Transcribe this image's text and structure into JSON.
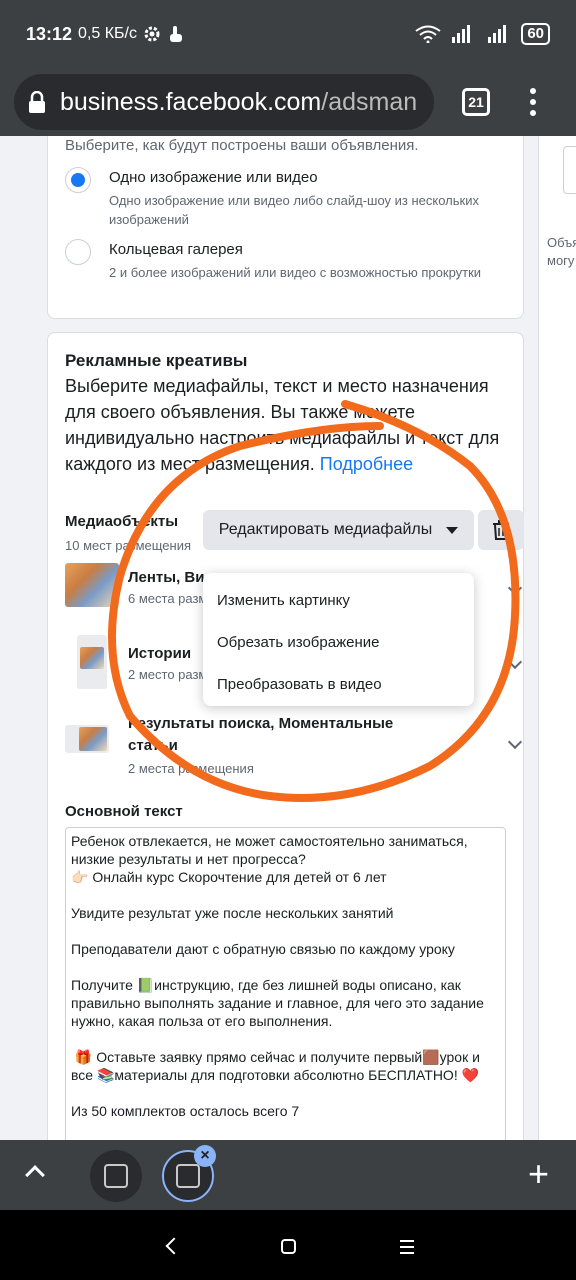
{
  "status": {
    "time": "13:12",
    "speed": "0,5 КБ/с",
    "battery": "60"
  },
  "browser": {
    "url_host": "business.facebook.com",
    "url_path": "/adsman",
    "tab_count": "21"
  },
  "format": {
    "intro": "Выберите, как будут построены ваши объявления.",
    "options": [
      {
        "title": "Одно изображение или видео",
        "desc": "Одно изображение или видео либо слайд-шоу из нескольких изображений",
        "selected": true
      },
      {
        "title": "Кольцевая галерея",
        "desc": "2 и более изображений или видео с возможностью прокрутки",
        "selected": false
      }
    ]
  },
  "right_panel": {
    "text_line1": "Объя",
    "text_line2": "могу"
  },
  "creatives": {
    "title": "Рекламные креативы",
    "description": "Выберите медиафайлы, текст и место назначения для своего объявления. Вы также можете индивидуально настроить медиафайлы и текст для каждого из мест размещения. ",
    "learn_more": "Подробнее",
    "media_label": "Медиаобъекты",
    "media_count": "10 мест размещения",
    "edit_media_button": "Редактировать медиафайлы",
    "placements": [
      {
        "title": "Ленты, Ви",
        "sub": "6 места разм"
      },
      {
        "title": "Истории",
        "sub": "2 место разм"
      },
      {
        "title": "Результаты поиска, Моментальные статьи",
        "sub": "2 места размещения"
      }
    ],
    "dropdown": [
      "Изменить картинку",
      "Обрезать изображение",
      "Преобразовать в видео"
    ],
    "primary_text_label": "Основной текст",
    "primary_text": "Ребенок отвлекается, не может самостоятельно заниматься, низкие результаты и нет прогресса?\n👉🏻 Онлайн курс Скорочтение для детей от 6 лет\n\nУвидите результат уже после нескольких занятий\n\nПреподаватели дают с обратную связью по каждому уроку\n\nПолучите 📗инструкцию, где без лишней воды описано, как правильно выполнять задание и главное, для чего это задание нужно, какая польза от его выполнения.\n\n 🎁 Оставьте заявку прямо сейчас и получите первый🟫урок и все 📚материалы для подготовки абсолютно БЕСПЛАТНО! ❤️\n\nИз 50 комплектов осталось всего 7\n\n"
  },
  "colors": {
    "accent": "#1877f2",
    "annotation": "#f26a1b",
    "chrome_dark": "#3c4043"
  }
}
